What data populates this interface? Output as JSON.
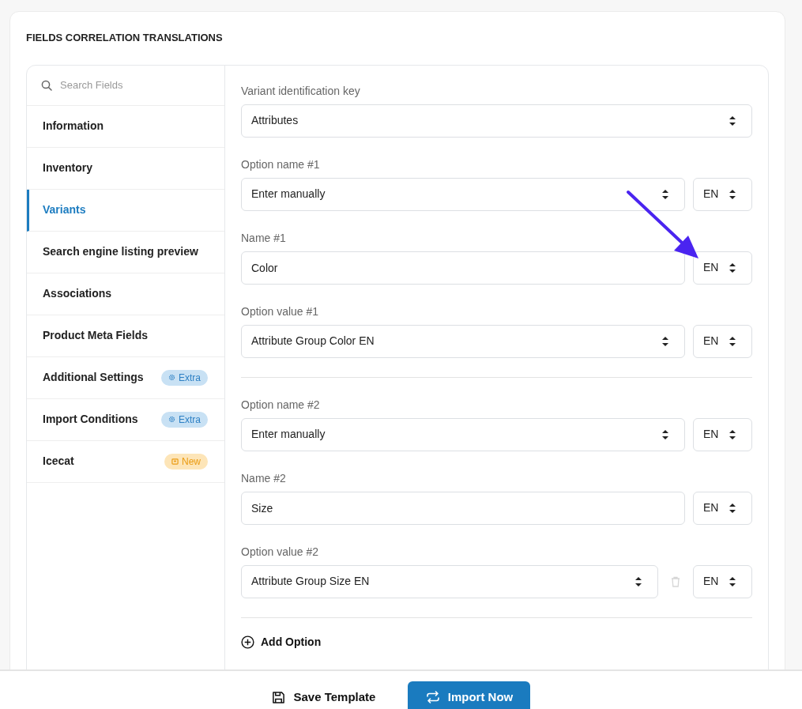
{
  "section_title": "FIELDS CORRELATION TRANSLATIONS",
  "search": {
    "placeholder": "Search Fields"
  },
  "sidebar": {
    "items": [
      {
        "label": "Information",
        "selected": false
      },
      {
        "label": "Inventory",
        "selected": false
      },
      {
        "label": "Variants",
        "selected": true
      },
      {
        "label": "Search engine listing preview",
        "selected": false
      },
      {
        "label": "Associations",
        "selected": false
      },
      {
        "label": "Product Meta Fields",
        "selected": false
      },
      {
        "label": "Additional Settings",
        "selected": false,
        "badge": {
          "text": "Extra",
          "kind": "extra"
        }
      },
      {
        "label": "Import Conditions",
        "selected": false,
        "badge": {
          "text": "Extra",
          "kind": "extra"
        }
      },
      {
        "label": "Icecat",
        "selected": false,
        "badge": {
          "text": "New",
          "kind": "new"
        }
      }
    ]
  },
  "key_field": {
    "label": "Variant identification key",
    "value": "Attributes"
  },
  "option_groups": [
    {
      "rows": [
        {
          "label": "Option name #1",
          "kind": "select",
          "value": "Enter manually",
          "language": "EN",
          "deletable": false
        },
        {
          "label": "Name #1",
          "kind": "text",
          "value": "Color",
          "language": "EN",
          "deletable": false
        },
        {
          "label": "Option value #1",
          "kind": "select",
          "value": "Attribute Group Color EN",
          "language": "EN",
          "deletable": false
        }
      ]
    },
    {
      "rows": [
        {
          "label": "Option name #2",
          "kind": "select",
          "value": "Enter manually",
          "language": "EN",
          "deletable": false
        },
        {
          "label": "Name #2",
          "kind": "text",
          "value": "Size",
          "language": "EN",
          "deletable": false
        },
        {
          "label": "Option value #2",
          "kind": "select",
          "value": "Attribute Group Size EN",
          "language": "EN",
          "deletable": true
        }
      ]
    }
  ],
  "add_option": "Add Option",
  "footer": {
    "save": "Save Template",
    "import": "Import Now"
  }
}
